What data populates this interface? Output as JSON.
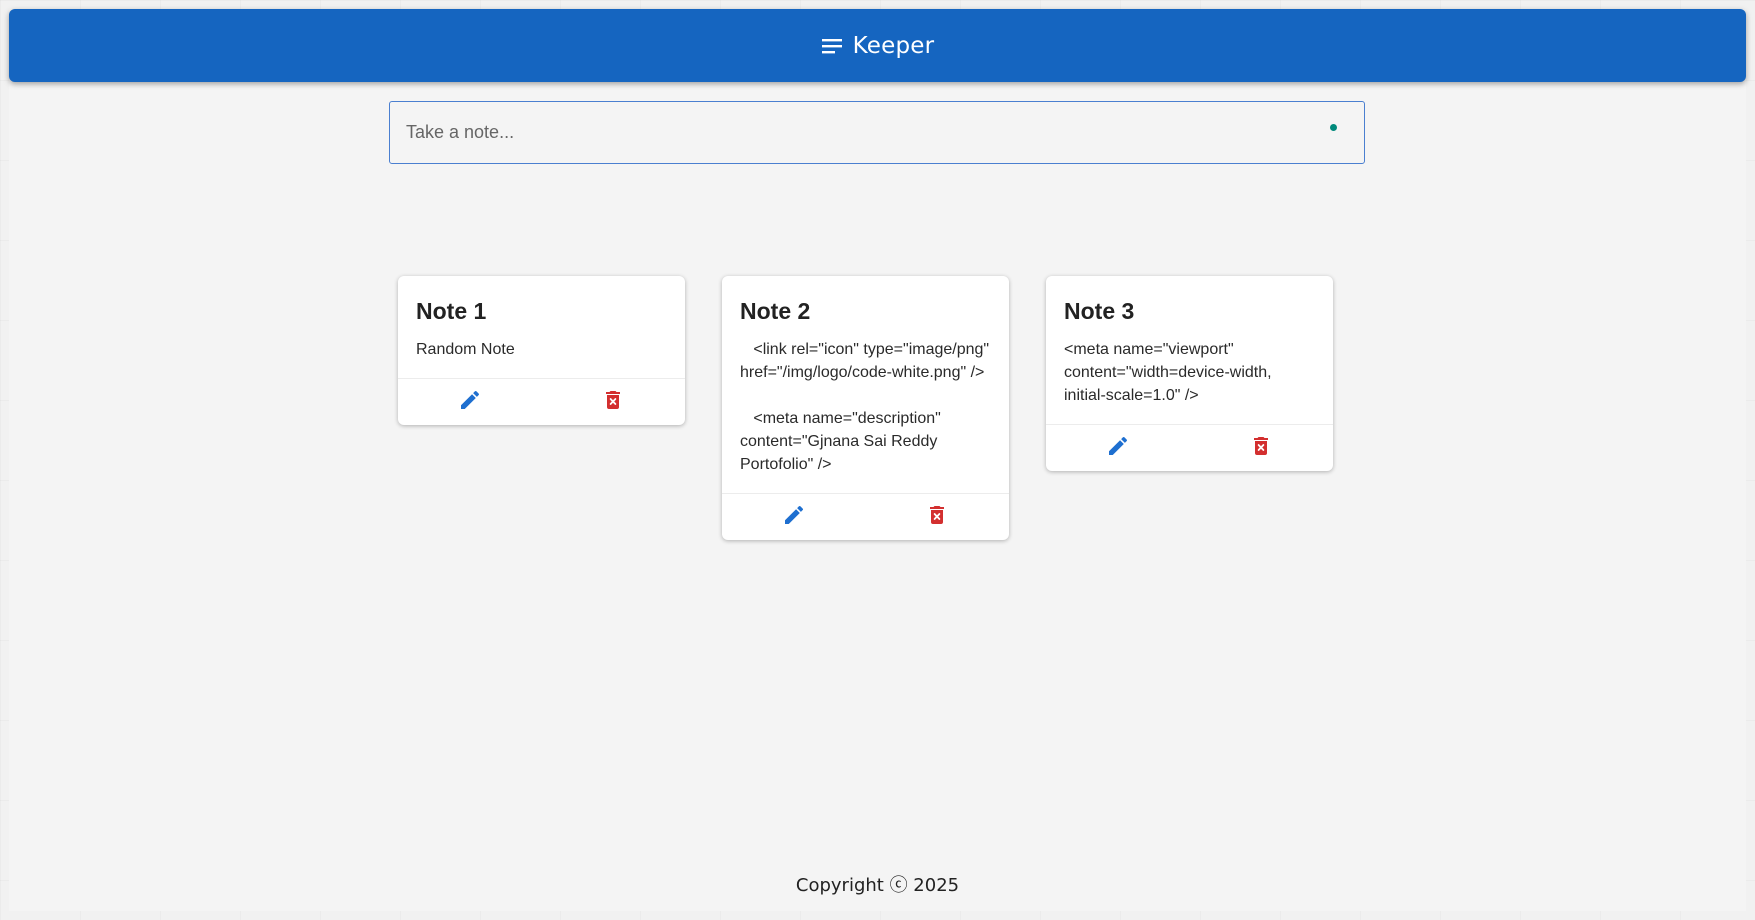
{
  "header": {
    "title": "Keeper",
    "menu_icon": "menu-icon",
    "background_color": "#1565c0"
  },
  "note_input": {
    "placeholder": "Take a note...",
    "value": "",
    "status_dot_color": "#00897b"
  },
  "notes": [
    {
      "title": "Note 1",
      "content": "Random Note",
      "edit_icon": "edit-icon",
      "delete_icon": "delete-icon"
    },
    {
      "title": "Note 2",
      "content": "   <link rel=\"icon\" type=\"image/png\" href=\"/img/logo/code-white.png\" />\n\n   <meta name=\"description\" content=\"Gjnana Sai Reddy Portofolio\" />",
      "edit_icon": "edit-icon",
      "delete_icon": "delete-icon"
    },
    {
      "title": "Note 3",
      "content": "<meta name=\"viewport\" content=\"width=device-width, initial-scale=1.0\" />",
      "edit_icon": "edit-icon",
      "delete_icon": "delete-icon"
    }
  ],
  "colors": {
    "edit": "#1e6fd0",
    "delete": "#d32f2f",
    "page_background": "#f4f4f4"
  },
  "footer": {
    "text": "Copyright ⓒ 2025"
  }
}
